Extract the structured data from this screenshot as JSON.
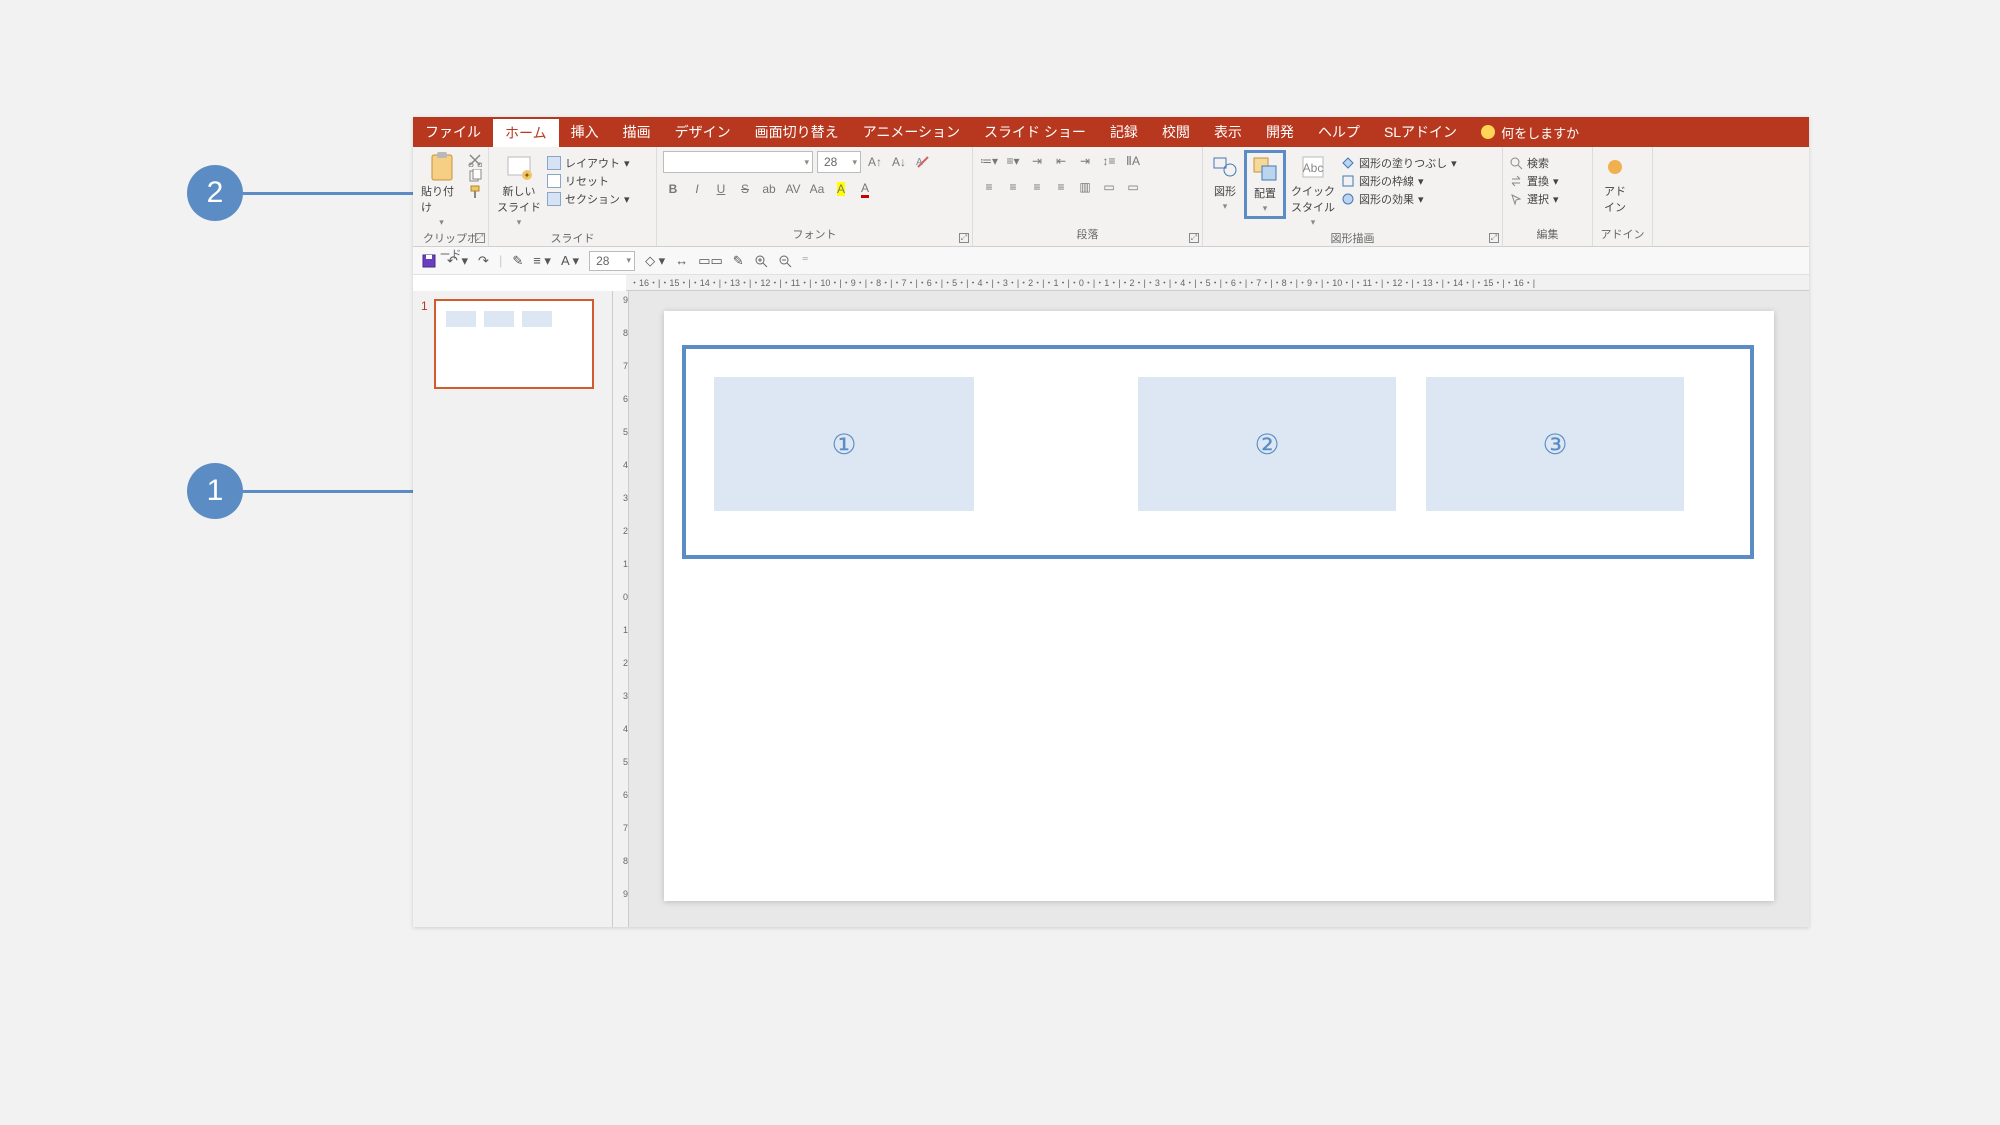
{
  "annotations": {
    "step1": "1",
    "step2": "2"
  },
  "tabs": [
    "ファイル",
    "ホーム",
    "挿入",
    "描画",
    "デザイン",
    "画面切り替え",
    "アニメーション",
    "スライド ショー",
    "記録",
    "校閲",
    "表示",
    "開発",
    "ヘルプ",
    "SLアドイン"
  ],
  "active_tab_index": 1,
  "tell_me": "何をしますか",
  "ribbon": {
    "clipboard": {
      "paste": "貼り付け",
      "label": "クリップボード"
    },
    "slides": {
      "new_slide": "新しい\nスライド",
      "layout": "レイアウト",
      "reset": "リセット",
      "section": "セクション",
      "label": "スライド"
    },
    "font": {
      "size": "28",
      "label": "フォント"
    },
    "paragraph": {
      "label": "段落"
    },
    "drawing": {
      "shapes": "図形",
      "arrange": "配置",
      "quick_styles": "クイック\nスタイル",
      "fill": "図形の塗りつぶし",
      "outline": "図形の枠線",
      "effects": "図形の効果",
      "label": "図形描画"
    },
    "editing": {
      "find": "検索",
      "replace": "置換",
      "select": "選択",
      "label": "編集"
    },
    "addins": {
      "addin": "アド\nイン",
      "label": "アドイン"
    }
  },
  "qat_font_size": "28",
  "ruler_h": "・16・|・15・|・14・|・13・|・12・|・11・|・10・|・9・|・8・|・7・|・6・|・5・|・4・|・3・|・2・|・1・|・0・|・1・|・2・|・3・|・4・|・5・|・6・|・7・|・8・|・9・|・10・|・11・|・12・|・13・|・14・|・15・|・16・|",
  "ruler_v": [
    "9",
    "8",
    "7",
    "6",
    "5",
    "4",
    "3",
    "2",
    "1",
    "0",
    "1",
    "2",
    "3",
    "4",
    "5",
    "6",
    "7",
    "8",
    "9"
  ],
  "thumb_number": "1",
  "slide_shapes": [
    "①",
    "②",
    "③"
  ]
}
